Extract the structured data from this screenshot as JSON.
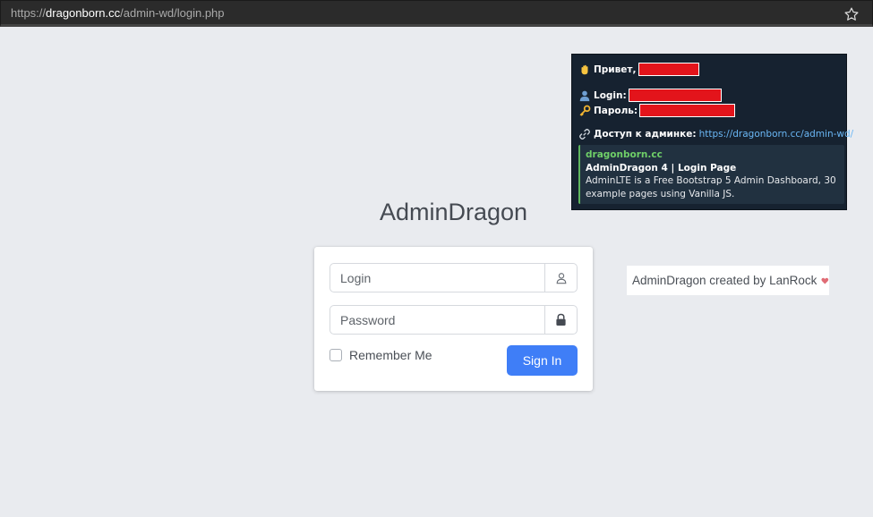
{
  "browser": {
    "url_scheme": "https://",
    "url_host": "dragonborn.cc",
    "url_path": "/admin-wd/login.php",
    "bookmark_icon": "star-icon"
  },
  "telegram": {
    "greeting": "Привет,",
    "login_label": "Login:",
    "password_label": "Пароль:",
    "access_label": "Доступ к админке:",
    "access_link": "https://dragonborn.cc/admin-wd/",
    "preview": {
      "site": "dragonborn.cc",
      "title": "AdminDragon 4 | Login Page",
      "description": "AdminLTE is a Free Bootstrap 5 Admin Dashboard, 30 example pages using Vanilla JS."
    },
    "colors": {
      "redaction": "#e3141b",
      "link": "#6ab7f5",
      "site": "#6fcf68"
    }
  },
  "login": {
    "brand": "AdminDragon",
    "login_placeholder": "Login",
    "password_placeholder": "Password",
    "remember_label": "Remember Me",
    "signin_label": "Sign In",
    "icons": {
      "login": "user-icon",
      "password": "lock-icon"
    },
    "accent": "#3f7ef7"
  },
  "credit": {
    "text": "AdminDragon created by LanRock",
    "icon": "heart-icon"
  }
}
